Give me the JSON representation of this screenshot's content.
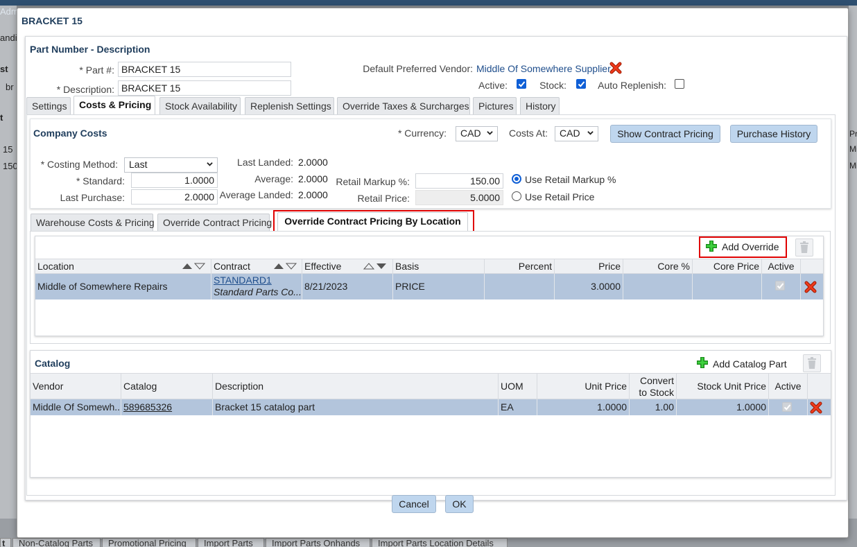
{
  "background": {
    "left_texts": [
      "Adm",
      "andi",
      "st",
      "br",
      "t",
      "15",
      "150"
    ],
    "right_texts": [
      "Pro",
      "Mi",
      "Mi"
    ],
    "bottom_tabs": [
      "t",
      "Non-Catalog Parts",
      "Promotional Pricing",
      "Import Parts",
      "Import Parts Onhands",
      "Import Parts Location Details"
    ]
  },
  "dialog": {
    "title": "BRACKET 15",
    "section_title": "Part Number - Description",
    "part_label": "* Part #:",
    "part_value": "BRACKET 15",
    "desc_label": "* Description:",
    "desc_value": "BRACKET 15",
    "vendor_label": "Default Preferred Vendor:",
    "vendor_value": "Middle Of Somewhere Supplier",
    "active_label": "Active:",
    "active_checked": true,
    "stock_label": "Stock:",
    "stock_checked": true,
    "replenish_label": "Auto Replenish:",
    "replenish_checked": false,
    "cancel_label": "Cancel",
    "ok_label": "OK"
  },
  "tabs": [
    {
      "label": "Settings",
      "active": false
    },
    {
      "label": "Costs & Pricing",
      "active": true
    },
    {
      "label": "Stock Availability",
      "active": false
    },
    {
      "label": "Replenish Settings",
      "active": false
    },
    {
      "label": "Override Taxes & Surcharges",
      "active": false
    },
    {
      "label": "Pictures",
      "active": false
    },
    {
      "label": "History",
      "active": false
    }
  ],
  "company_costs": {
    "title": "Company Costs",
    "currency_label": "* Currency:",
    "currency_value": "CAD",
    "costs_at_label": "Costs At:",
    "costs_at_value": "CAD",
    "show_contract_btn": "Show Contract Pricing",
    "purchase_history_btn": "Purchase History",
    "costing_method_label": "* Costing Method:",
    "costing_method_value": "Last",
    "standard_label": "* Standard:",
    "standard_value": "1.0000",
    "last_purchase_label": "Last Purchase:",
    "last_purchase_value": "2.0000",
    "last_landed_label": "Last Landed:",
    "last_landed_value": "2.0000",
    "average_label": "Average:",
    "average_value": "2.0000",
    "average_landed_label": "Average Landed:",
    "average_landed_value": "2.0000",
    "retail_markup_label": "Retail Markup %:",
    "retail_markup_value": "150.00",
    "retail_price_label": "Retail Price:",
    "retail_price_value": "5.0000",
    "use_markup_label": "Use Retail Markup %",
    "use_price_label": "Use Retail Price"
  },
  "subtabs": [
    {
      "label": "Warehouse Costs & Pricing",
      "active": false
    },
    {
      "label": "Override Contract Pricing",
      "active": false
    },
    {
      "label": "Override Contract Pricing By Location",
      "active": true
    }
  ],
  "override_grid": {
    "add_label": "Add Override",
    "columns": [
      "Location",
      "Contract",
      "Effective",
      "Basis",
      "Percent",
      "Price",
      "Core %",
      "Core Price",
      "Active"
    ],
    "rows": [
      {
        "location": "Middle of Somewhere Repairs",
        "contract_code": "STANDARD1",
        "contract_name": "Standard Parts Co...",
        "effective": "8/21/2023",
        "basis": "PRICE",
        "percent": "",
        "price": "3.0000",
        "core_pct": "",
        "core_price": "",
        "active": true
      }
    ]
  },
  "catalog": {
    "title": "Catalog",
    "add_label": "Add Catalog Part",
    "columns": [
      "Vendor",
      "Catalog",
      "Description",
      "UOM",
      "Unit Price",
      "Convert",
      "to Stock",
      "Stock Unit Price",
      "Active"
    ],
    "rows": [
      {
        "vendor": "Middle Of Somewh...",
        "catalog": "589685326",
        "description": "Bracket 15 catalog part",
        "uom": "EA",
        "unit_price": "1.0000",
        "convert": "1.00",
        "stock_unit_price": "1.0000",
        "active": true
      }
    ]
  },
  "colors": {
    "accent": "#0f5fd6",
    "title": "#1f3d5c",
    "highlight": "#e00000",
    "selected_row": "#b3c5dc",
    "button": "#bfd6ee"
  }
}
